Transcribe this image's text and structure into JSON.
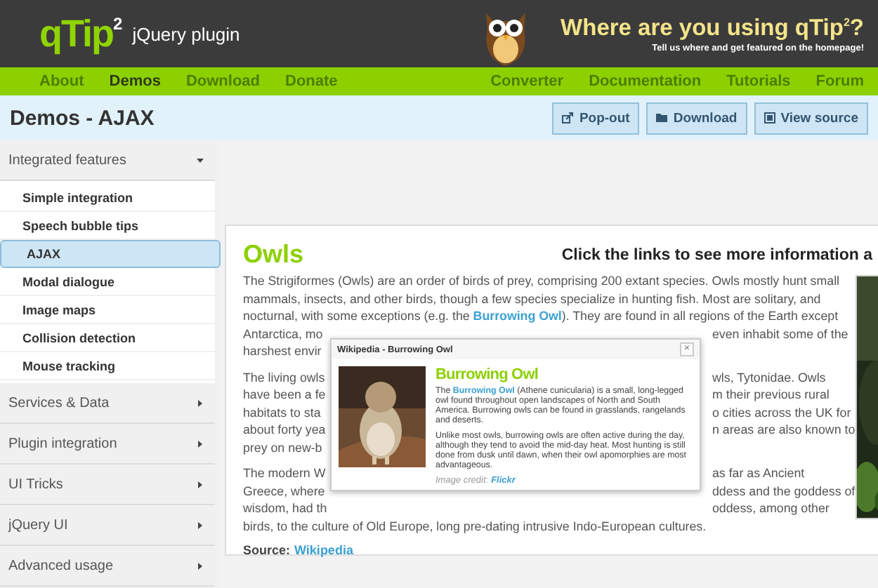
{
  "header": {
    "logo": "qTip$^{2}$",
    "tagline": "jQuery plugin",
    "promo_title": "Where are you using qTip$^{2}$?",
    "promo_subtitle": "Tell us where and get featured on the homepage!"
  },
  "nav": {
    "left": [
      {
        "label": "About",
        "selected": false
      },
      {
        "label": "Demos",
        "selected": true
      },
      {
        "label": "Download",
        "selected": false
      },
      {
        "label": "Donate",
        "selected": false
      }
    ],
    "right": [
      {
        "label": "Converter",
        "selected": false
      },
      {
        "label": "Documentation",
        "selected": false
      },
      {
        "label": "Tutorials",
        "selected": false
      },
      {
        "label": "Forum",
        "selected": false
      }
    ]
  },
  "page_title": "Demos - AJAX",
  "toolbar": [
    {
      "label": "Pop-out",
      "kind": "popout"
    },
    {
      "label": "Download",
      "kind": "folder"
    },
    {
      "label": "View source",
      "kind": "source"
    }
  ],
  "sidebar": [
    {
      "label": "Integrated features",
      "expanded": true,
      "items": [
        {
          "label": "Simple integration",
          "selected": false
        },
        {
          "label": "Speech bubble tips",
          "selected": false
        },
        {
          "label": "AJAX",
          "selected": true
        },
        {
          "label": "Modal dialogue",
          "selected": false
        },
        {
          "label": "Image maps",
          "selected": false
        },
        {
          "label": "Collision detection",
          "selected": false
        },
        {
          "label": "Mouse tracking",
          "selected": false
        }
      ]
    },
    {
      "label": "Services & Data",
      "expanded": false
    },
    {
      "label": "Plugin integration",
      "expanded": false
    },
    {
      "label": "UI Tricks",
      "expanded": false
    },
    {
      "label": "jQuery UI",
      "expanded": false
    },
    {
      "label": "Advanced usage",
      "expanded": false
    }
  ],
  "article": {
    "title": "Owls",
    "heading": "Click the links to see more information a",
    "paragraphs": [
      [
        {
          "kind": "full",
          "text": "The Strigiformes (Owls) are an order of birds of prey, comprising 200 extant species. Owls mostly hunt small"
        },
        {
          "kind": "full",
          "text": "mammals, insects, and other birds, though a few species specialize in hunting fish. Most are solitary, and"
        },
        {
          "kind": "link",
          "before": "nocturnal, with some exceptions (e.g. the ",
          "link": "Burrowing Owl",
          "after": "). They are found in all regions of the Earth except"
        },
        {
          "kind": "split",
          "left": "Antarctica, mo",
          "right": "even inhabit some of the"
        },
        {
          "kind": "split",
          "left": "harshest envir"
        }
      ],
      [
        {
          "kind": "split",
          "left": "The living owls",
          "right": "wls, Tytonidae. Owls"
        },
        {
          "kind": "split",
          "left": "have been a fe",
          "right": "m their previous rural"
        },
        {
          "kind": "split",
          "left": "habitats to sta",
          "right": "o cities across the UK for"
        },
        {
          "kind": "split",
          "left": "about forty yea",
          "right": "n areas are also known to"
        },
        {
          "kind": "split",
          "left": "prey on new-b"
        }
      ],
      [
        {
          "kind": "split",
          "left": "The modern W",
          "right": "as far as Ancient"
        },
        {
          "kind": "split",
          "left": "Greece, where",
          "right": "ddess and the goddess of"
        },
        {
          "kind": "split",
          "left": "wisdom, had th",
          "right": "oddess, among other"
        },
        {
          "kind": "full",
          "text": "birds, to the culture of Old Europe, long pre-dating intrusive Indo-European cultures."
        }
      ]
    ],
    "source_label": "Source:",
    "source_link": "Wikipedia"
  },
  "tooltip": {
    "title": "Wikipedia - Burrowing Owl",
    "close": "×",
    "heading": "Burrowing Owl",
    "paragraphs": [
      {
        "before": "The ",
        "link": "Burrowing Owl",
        "after": " (Athene cunicularia) is a small, long-legged owl found throughout open landscapes of North and South America. Burrowing owls can be found in grasslands, rangelands and deserts."
      },
      {
        "before": "Unlike most owls, burrowing owls are often active during the day, although they tend to avoid the mid-day heat. Most hunting is still done from dusk until dawn, when their owl apomorphies are most advantageous."
      }
    ],
    "credit_label": "Image credit:",
    "credit_link": "Flickr"
  }
}
